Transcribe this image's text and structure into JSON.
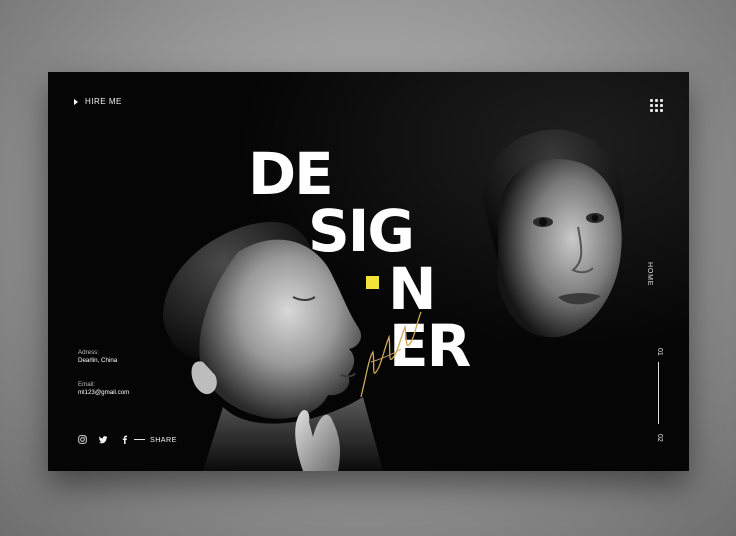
{
  "nav": {
    "hire_label": "HIRE ME",
    "menu_icon": "grid-menu-icon"
  },
  "hero": {
    "line1": "DE",
    "line2": "SIG",
    "line3": "N",
    "line4": "ER",
    "accent_color": "#F4E23A",
    "signature": "Mila Laura"
  },
  "contact": {
    "address_label": "Adress:",
    "address_value": "Dearlin, China",
    "email_label": "Email:",
    "email_value": "ml123@gmail.com"
  },
  "social": {
    "icons": [
      "instagram-icon",
      "twitter-icon",
      "facebook-icon"
    ],
    "share_label": "SHARE"
  },
  "rail": {
    "home_label": "HOME",
    "page_current": "01",
    "page_next": "02"
  }
}
